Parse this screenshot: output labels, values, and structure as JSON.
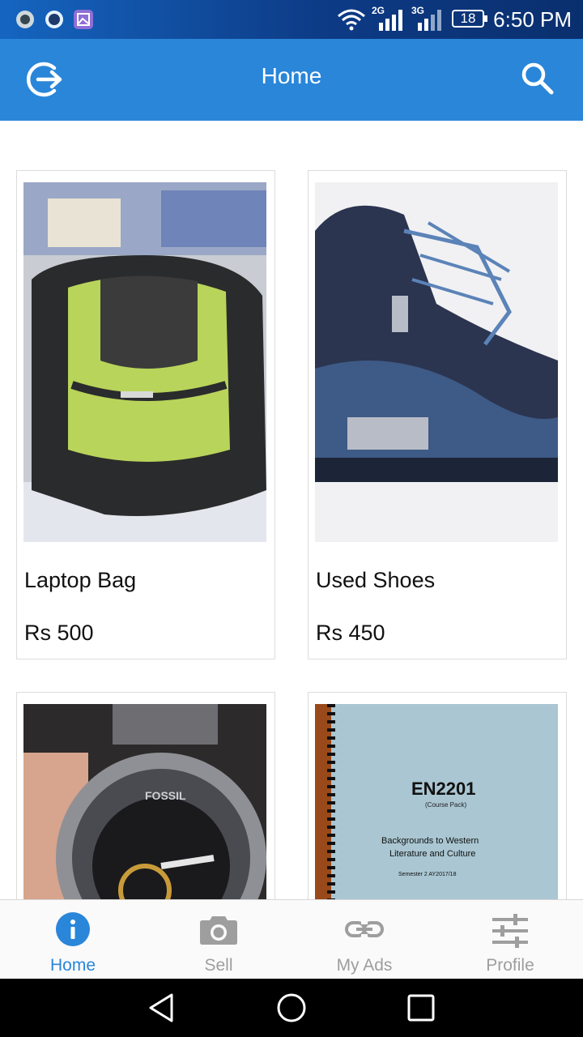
{
  "status_bar": {
    "time": "6:50 PM",
    "battery": "18",
    "network_1": "2G",
    "network_2": "3G",
    "icons": [
      "app-notification-icon",
      "messenger-icon",
      "gallery-icon",
      "wifi-icon",
      "signal-icon",
      "signal-icon",
      "battery-icon"
    ]
  },
  "app_bar": {
    "title": "Home",
    "left_icon": "logout-icon",
    "right_icon": "search-icon",
    "color": "#2a86d9"
  },
  "listings": [
    {
      "title": "Laptop Bag",
      "price": "Rs 500",
      "image": "green-black-backpack-photo"
    },
    {
      "title": "Used Shoes",
      "price": "Rs 450",
      "image": "blue-sneakers-photo"
    },
    {
      "title": "",
      "price": "",
      "image": "fossil-watch-photo",
      "image_text": "FOSSIL"
    },
    {
      "title": "",
      "price": "",
      "image": "course-pack-book-photo",
      "image_text": {
        "code": "EN2201",
        "sub": "(Course Pack)",
        "line1": "Backgrounds to Western",
        "line2": "Literature and Culture",
        "line3": "Semester 2 AY2017/18"
      }
    }
  ],
  "bottom_nav": {
    "items": [
      {
        "label": "Home",
        "icon": "info-icon",
        "active": true
      },
      {
        "label": "Sell",
        "icon": "camera-icon",
        "active": false
      },
      {
        "label": "My Ads",
        "icon": "link-icon",
        "active": false
      },
      {
        "label": "Profile",
        "icon": "sliders-icon",
        "active": false
      }
    ],
    "active_color": "#2a86d9",
    "inactive_color": "#9e9e9e"
  },
  "system_nav": {
    "icons": [
      "back-icon",
      "home-icon",
      "recents-icon"
    ]
  }
}
